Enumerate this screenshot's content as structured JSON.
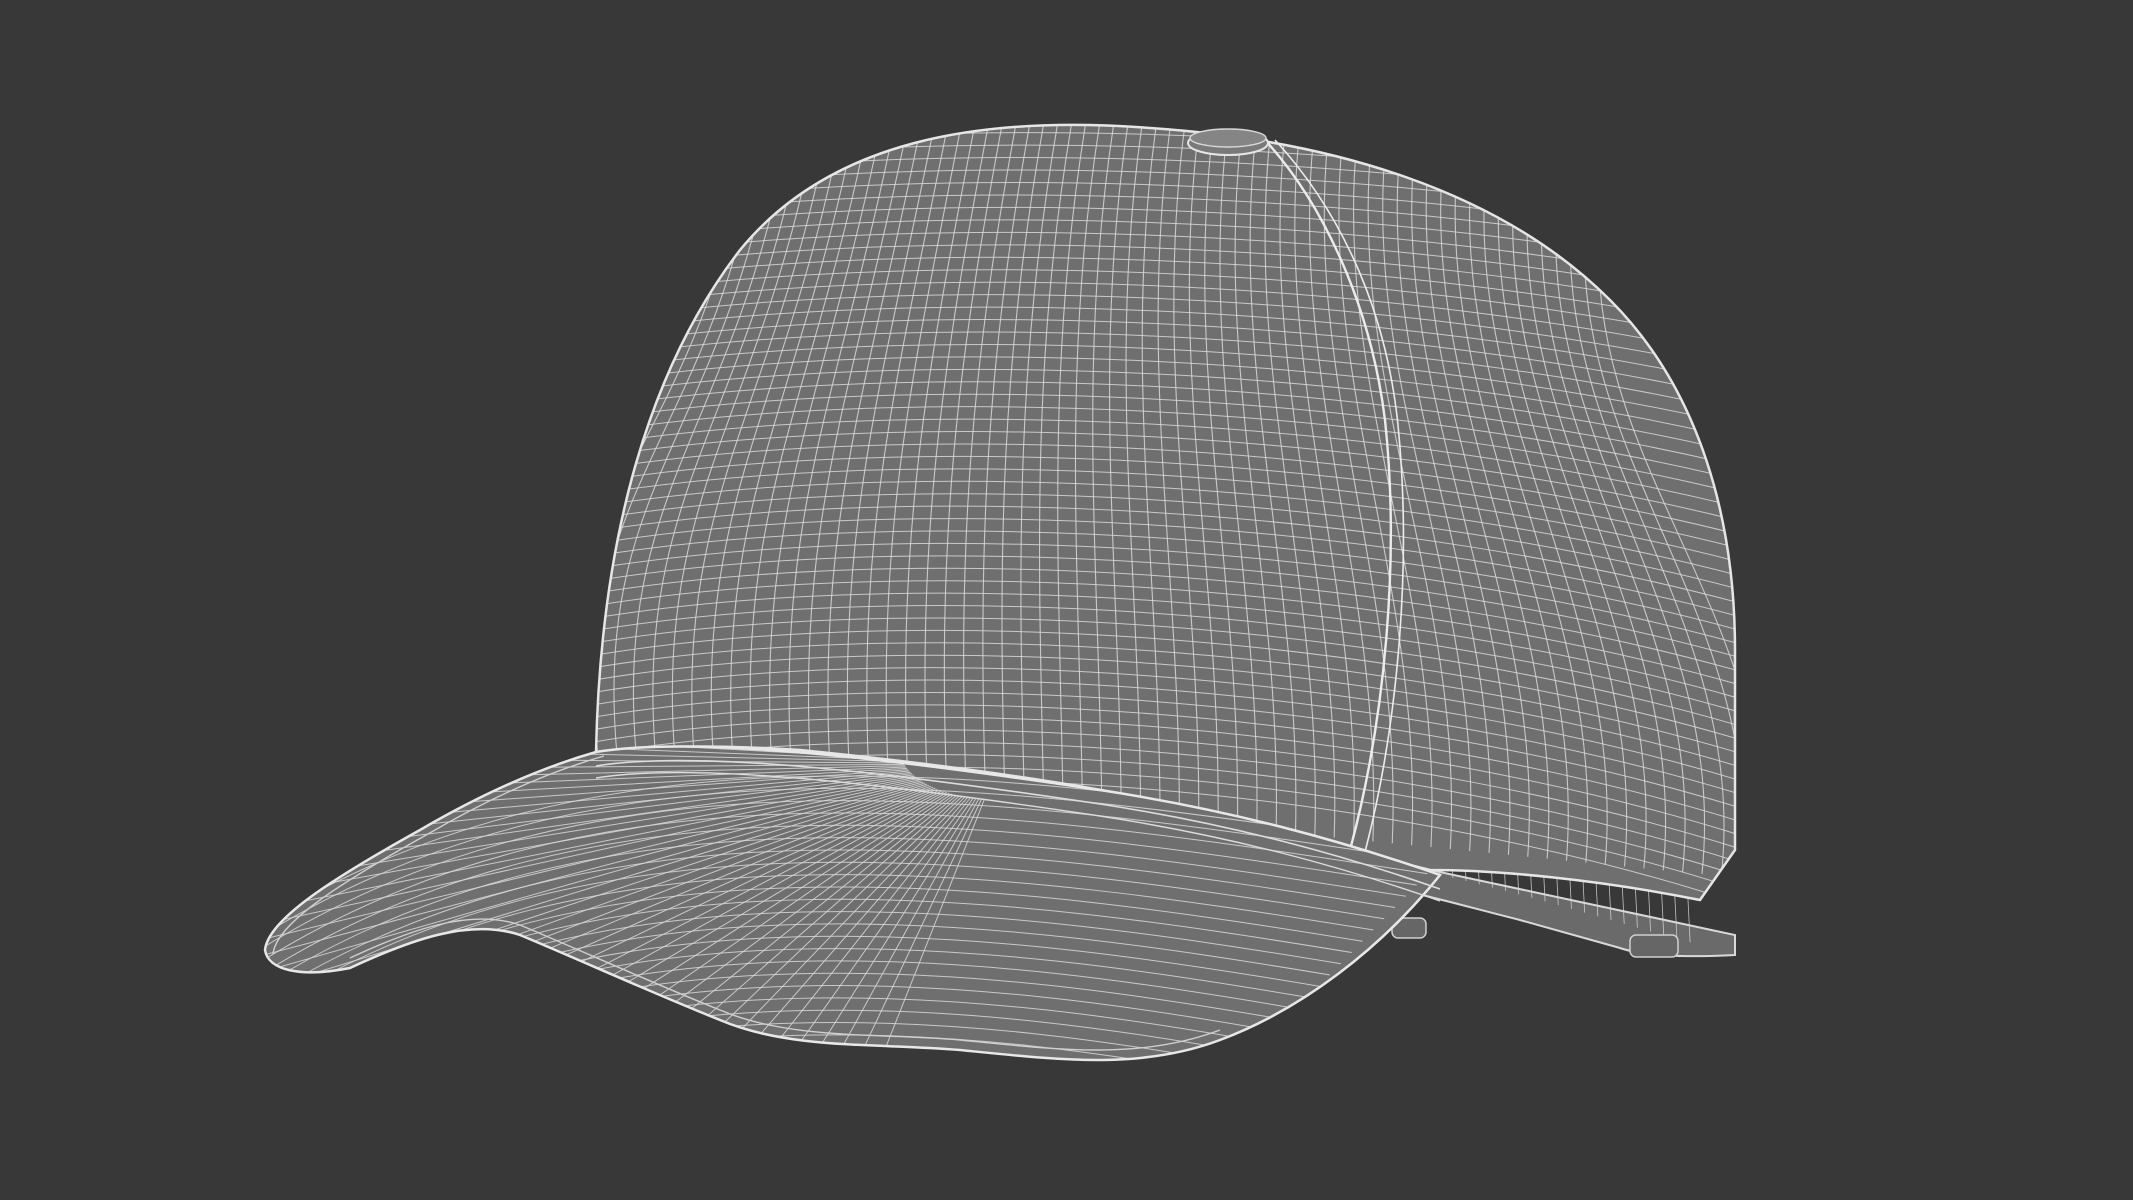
{
  "scene": {
    "background_color": "#383838",
    "model_fill_color": "#6f6f6f",
    "wire_color": "#d9d9d9",
    "edge_color": "#e6e6e6",
    "subject": "baseball-cap-wireframe"
  }
}
